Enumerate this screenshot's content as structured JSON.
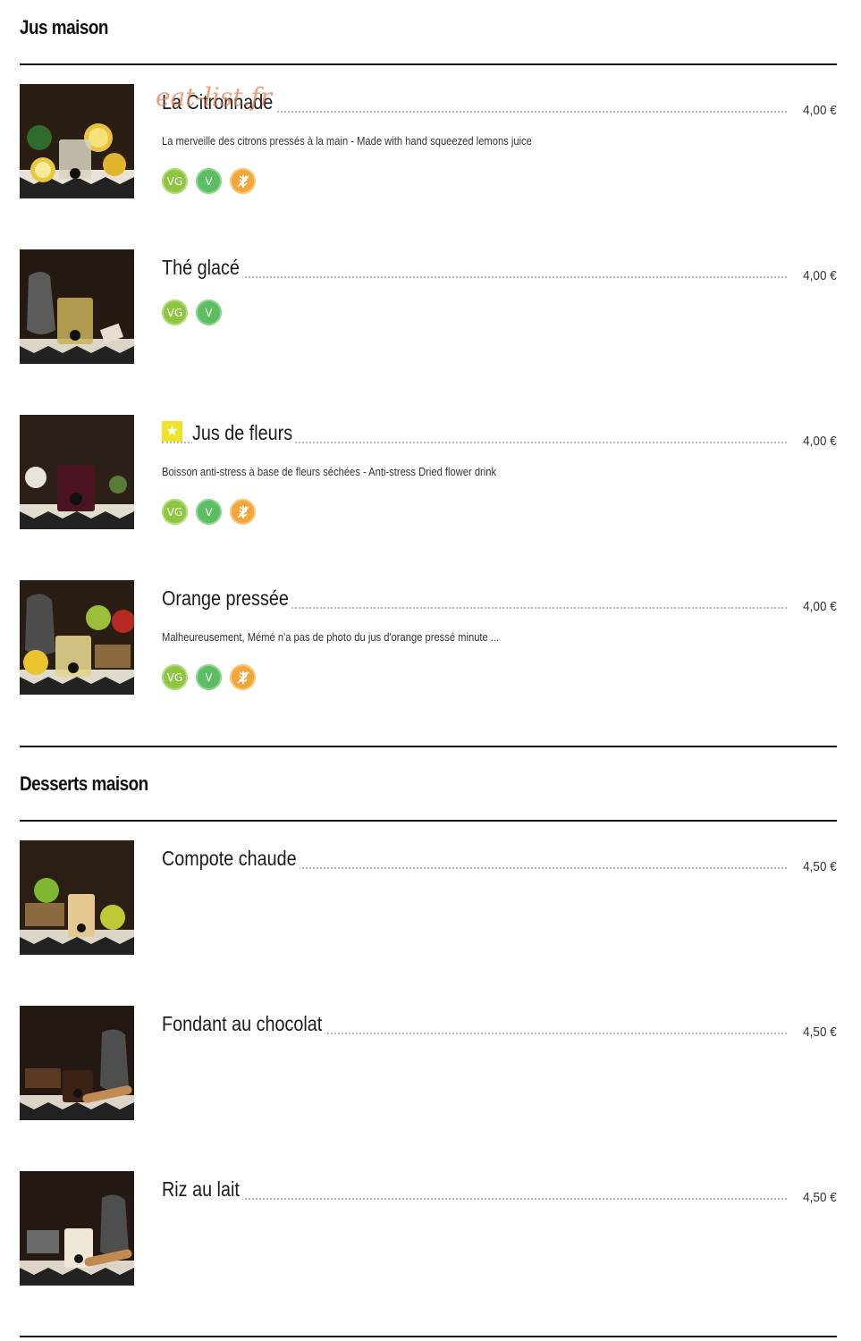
{
  "watermark": "eat-list.fr",
  "sections": [
    {
      "title": "Jus maison",
      "items": [
        {
          "name": "La Citronnade",
          "price": "4,00 €",
          "description": "La merveille des citrons pressés à la main - Made with hand squeezed lemons juice",
          "badges": [
            "VG",
            "V",
            "gluten-free-icon"
          ],
          "featured": false,
          "image": "lemonade-photo"
        },
        {
          "name": "Thé glacé",
          "price": "4,00 €",
          "description": "",
          "badges": [
            "VG",
            "V"
          ],
          "featured": false,
          "image": "iced-tea-photo"
        },
        {
          "name": "Jus de fleurs",
          "price": "4,00 €",
          "description": "Boisson anti-stress à base de fleurs séchées - Anti-stress Dried flower drink",
          "badges": [
            "VG",
            "V",
            "gluten-free-icon"
          ],
          "featured": true,
          "featured_icon": "star-icon",
          "image": "flower-juice-photo"
        },
        {
          "name": "Orange pressée",
          "price": "4,00 €",
          "description": "Malheureusement, Mémé n'a pas de photo du jus d'orange pressé minute ...",
          "badges": [
            "VG",
            "V",
            "gluten-free-icon"
          ],
          "featured": false,
          "image": "orange-juice-photo"
        }
      ]
    },
    {
      "title": "Desserts maison",
      "items": [
        {
          "name": "Compote chaude",
          "price": "4,50 €",
          "description": "",
          "badges": [],
          "featured": false,
          "image": "compote-photo"
        },
        {
          "name": "Fondant au chocolat",
          "price": "4,50 €",
          "description": "",
          "badges": [],
          "featured": false,
          "image": "chocolate-fondant-photo"
        },
        {
          "name": "Riz au lait",
          "price": "4,50 €",
          "description": "",
          "badges": [],
          "featured": false,
          "image": "rice-pudding-photo"
        }
      ]
    }
  ],
  "colors": {
    "vg_badge": "#8ec642",
    "v_badge": "#5cbd62",
    "gluten_free_badge": "#f2a63a",
    "featured_star": "#ece32a",
    "watermark": "#e87846"
  }
}
